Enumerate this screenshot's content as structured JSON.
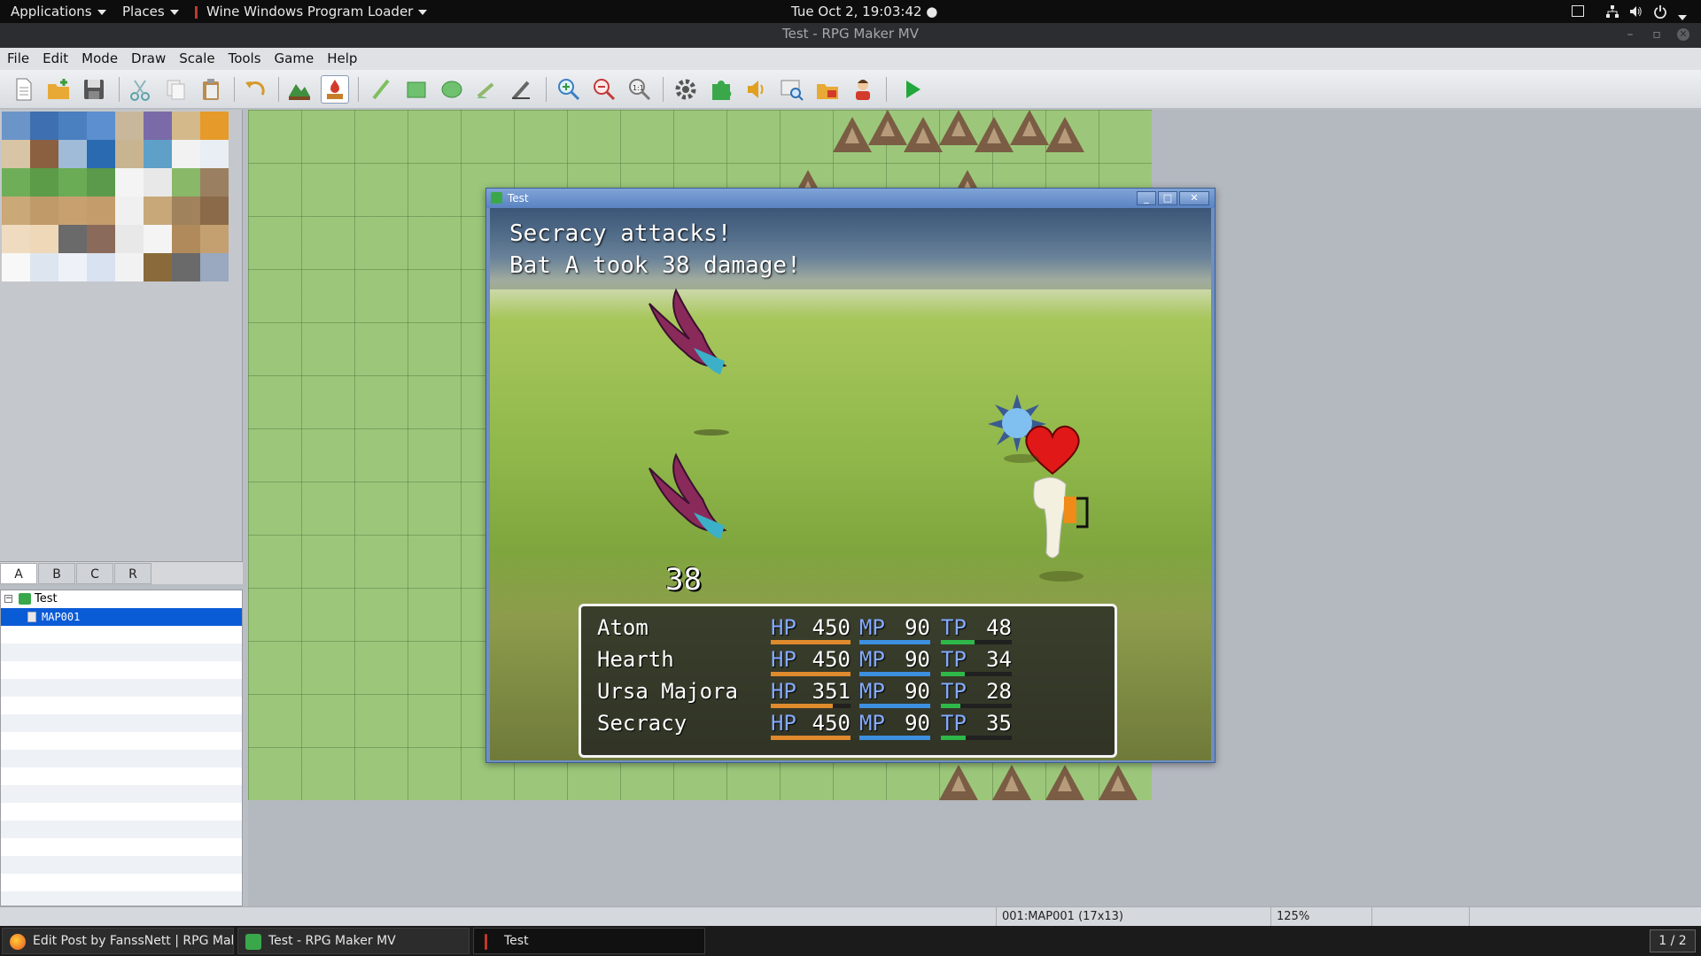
{
  "topbar": {
    "applications": "Applications",
    "places": "Places",
    "active_app": "Wine Windows Program Loader",
    "clock": "Tue Oct  2, 19:03:42 ●"
  },
  "window": {
    "title": "Test - RPG Maker MV"
  },
  "menu": [
    "File",
    "Edit",
    "Mode",
    "Draw",
    "Scale",
    "Tools",
    "Game",
    "Help"
  ],
  "tileset_tabs": [
    "A",
    "B",
    "C",
    "R"
  ],
  "map_tree": {
    "project": "Test",
    "map": "MAP001"
  },
  "game_window": {
    "title": "Test",
    "message_line1": "Secracy attacks!",
    "message_line2": "Bat A took 38 damage!",
    "damage_popup": "38"
  },
  "party": [
    {
      "name": "Atom",
      "hp": "450",
      "mp": "90",
      "tp": "48",
      "hp_frac": 1.0,
      "mp_frac": 1.0,
      "tp_frac": 0.48
    },
    {
      "name": "Hearth",
      "hp": "450",
      "mp": "90",
      "tp": "34",
      "hp_frac": 1.0,
      "mp_frac": 1.0,
      "tp_frac": 0.34
    },
    {
      "name": "Ursa Majora",
      "hp": "351",
      "mp": "90",
      "tp": "28",
      "hp_frac": 0.78,
      "mp_frac": 1.0,
      "tp_frac": 0.28
    },
    {
      "name": "Secracy",
      "hp": "450",
      "mp": "90",
      "tp": "35",
      "hp_frac": 1.0,
      "mp_frac": 1.0,
      "tp_frac": 0.35
    }
  ],
  "gauge_labels": {
    "hp": "HP",
    "mp": "MP",
    "tp": "TP"
  },
  "colors": {
    "hp": "#e08a2e",
    "mp": "#3d8fe0",
    "tp": "#2fb84a",
    "selection": "#0a5bd6"
  },
  "statusbar": {
    "map_info": "001:MAP001 (17x13)",
    "zoom": "125%"
  },
  "taskbar": {
    "items": [
      "Edit Post by FanssNett | RPG Mak...",
      "Test - RPG Maker MV",
      "Test"
    ],
    "workspace": "1 / 2"
  }
}
